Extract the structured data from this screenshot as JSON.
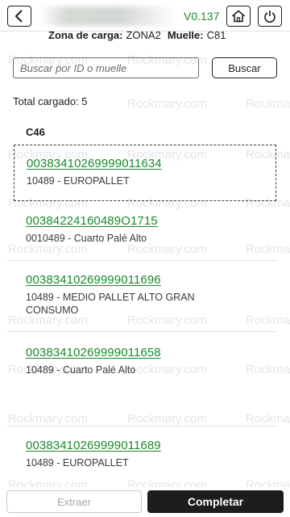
{
  "header": {
    "version": "V0.137"
  },
  "zone": {
    "zone_label": "Zona de carga:",
    "zone_value": "ZONA2",
    "dock_label": "Muelle:",
    "dock_value": "C81"
  },
  "search": {
    "placeholder": "Buscar por ID o muelle",
    "value": "",
    "button_label": "Buscar"
  },
  "total": {
    "label": "Total cargado: 5"
  },
  "group": {
    "title": "C46"
  },
  "pallets": [
    {
      "id": "00383410269999011634",
      "description": "10489 - EUROPALLET",
      "selected": true
    },
    {
      "id": "00384224160489O1715",
      "description": "0010489 - Cuarto Palé Alto",
      "selected": false
    },
    {
      "id": "00383410269999011696",
      "description": "10489 - MEDIO PALLET ALTO GRAN CONSUMO",
      "selected": false
    },
    {
      "id": "00383410269999011658",
      "description": "10489 - Cuarto Palé Alto",
      "selected": false
    },
    {
      "id": "00383410269999011689",
      "description": "10489 - EUROPALLET",
      "selected": false
    }
  ],
  "footer": {
    "extract_label": "Extraer",
    "complete_label": "Completar"
  },
  "watermark": {
    "text": "Rockmary.com"
  },
  "colors": {
    "accent_green": "#1a8a2a",
    "primary_button": "#1d1d1d",
    "disabled_text": "#a8a8a8"
  }
}
